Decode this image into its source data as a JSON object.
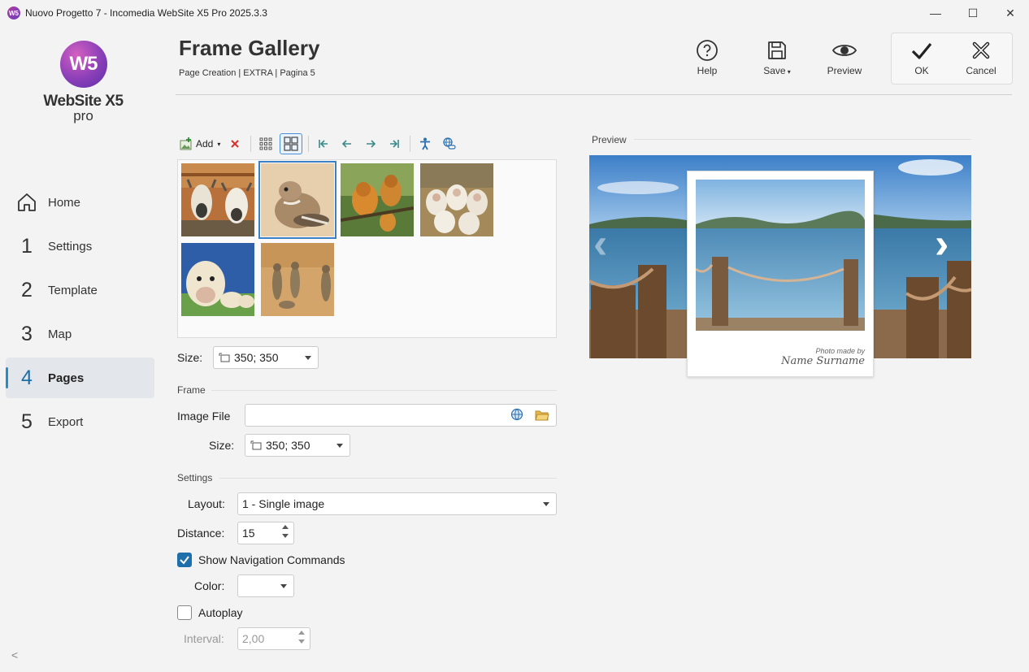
{
  "window": {
    "app_icon_text": "W5",
    "title": "Nuovo Progetto 7 - Incomedia WebSite X5 Pro 2025.3.3",
    "minimize": "—",
    "maximize": "☐",
    "close": "✕"
  },
  "logo": {
    "mark": "W5",
    "name": "WebSite X5",
    "edition": "pro"
  },
  "nav": {
    "items": [
      {
        "num": "",
        "label": "Home"
      },
      {
        "num": "1",
        "label": "Settings"
      },
      {
        "num": "2",
        "label": "Template"
      },
      {
        "num": "3",
        "label": "Map"
      },
      {
        "num": "4",
        "label": "Pages"
      },
      {
        "num": "5",
        "label": "Export"
      }
    ],
    "active_index": 4,
    "collapse": "<"
  },
  "header": {
    "title": "Frame Gallery",
    "breadcrumb": "Page Creation | EXTRA | Pagina 5",
    "tools": {
      "help": "Help",
      "save": "Save",
      "preview": "Preview",
      "ok": "OK",
      "cancel": "Cancel"
    }
  },
  "gallery_toolbar": {
    "add_label": "Add"
  },
  "thumbnails": [
    {
      "subject": "goats"
    },
    {
      "subject": "ground squirrel",
      "selected": true
    },
    {
      "subject": "monkeys"
    },
    {
      "subject": "sheep"
    },
    {
      "subject": "cows"
    },
    {
      "subject": "meerkats"
    }
  ],
  "form": {
    "size_label": "Size:",
    "size_value": "350; 350",
    "frame_section": "Frame",
    "image_file_label": "Image File",
    "image_file_value": "",
    "frame_size_label": "Size:",
    "frame_size_value": "350; 350",
    "settings_section": "Settings",
    "layout_label": "Layout:",
    "layout_value": "1 - Single image",
    "distance_label": "Distance:",
    "distance_value": "15",
    "show_nav_label": "Show Navigation Commands",
    "show_nav_checked": true,
    "color_label": "Color:",
    "autoplay_label": "Autoplay",
    "autoplay_checked": false,
    "interval_label": "Interval:",
    "interval_value": "2,00"
  },
  "preview": {
    "section": "Preview",
    "caption_small": "Photo made by",
    "caption_signature": "Name Surname",
    "prev_arrow": "‹",
    "next_arrow": "›"
  },
  "colors": {
    "accent": "#1f6fab",
    "nav_active_bg": "#e3e6ea",
    "logo_purple": "#8a3fb8"
  }
}
